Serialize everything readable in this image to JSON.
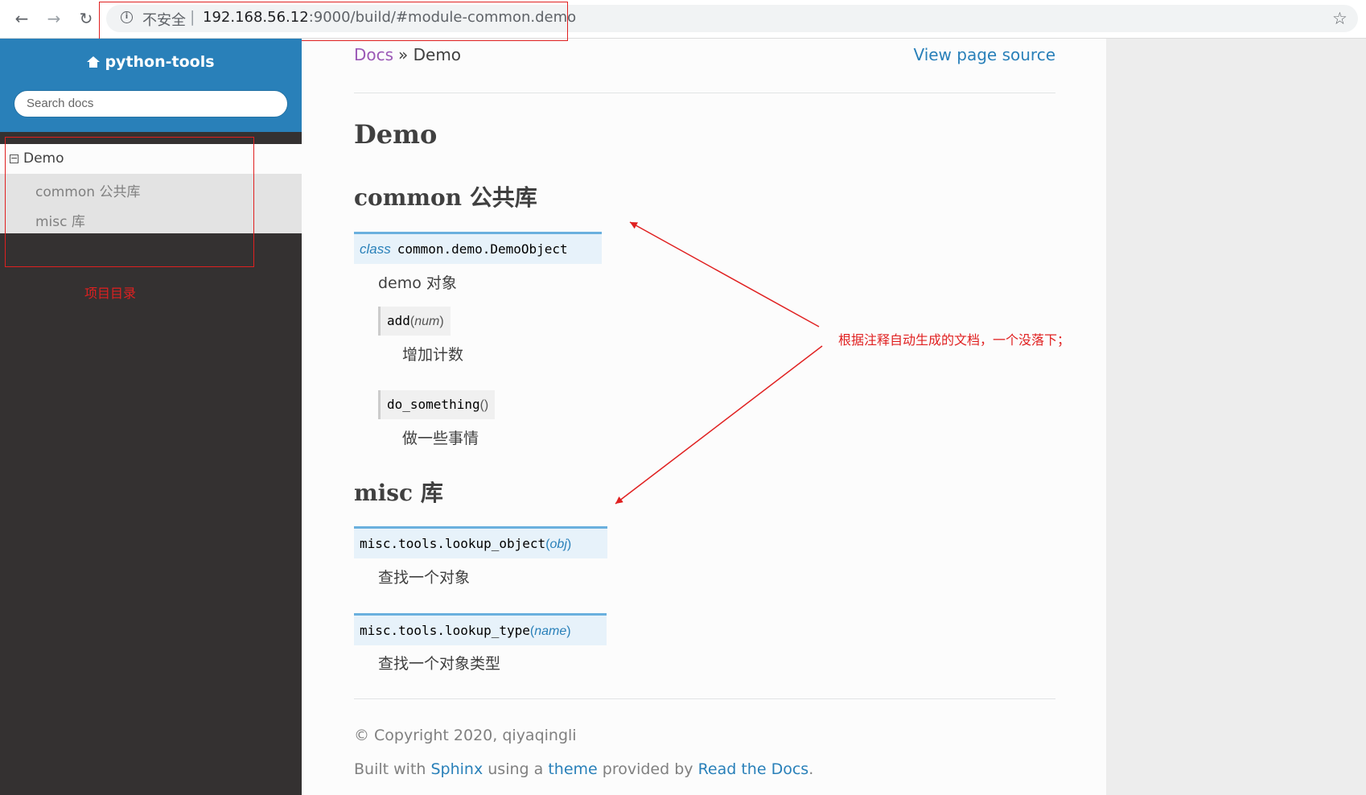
{
  "browser": {
    "insecure_label": "不安全",
    "separator": "|",
    "url_host": "192.168.56.12",
    "url_rest": ":9000/build/#module-common.demo"
  },
  "sidebar": {
    "brand": "python-tools",
    "search_placeholder": "Search docs",
    "toggle": "⊟",
    "current": "Demo",
    "items": [
      {
        "label": "common 公共库"
      },
      {
        "label": "misc 库"
      }
    ],
    "annotation": "项目目录"
  },
  "breadcrumb": {
    "docs": "Docs",
    "separator": "»",
    "current": "Demo",
    "view_source": "View page source"
  },
  "page": {
    "title": "Demo",
    "sections": [
      {
        "heading": "common 公共库",
        "class_keyword": "class",
        "class_name": "common.demo.DemoObject",
        "class_desc": "demo 对象",
        "methods": [
          {
            "name": "add",
            "param": "num",
            "desc": "增加计数"
          },
          {
            "name": "do_something",
            "param": "",
            "desc": "做一些事情"
          }
        ]
      },
      {
        "heading": "misc 库",
        "functions": [
          {
            "name": "misc.tools.lookup_object",
            "param": "obj",
            "desc": "查找一个对象"
          },
          {
            "name": "misc.tools.lookup_type",
            "param": "name",
            "desc": "查找一个对象类型"
          }
        ]
      }
    ]
  },
  "footer": {
    "copyright": "© Copyright 2020, qiyaqingli",
    "built_prefix": "Built with",
    "sphinx": "Sphinx",
    "using_a": "using a",
    "theme": "theme",
    "provided_by": "provided by",
    "rtd": "Read the Docs",
    "period": "."
  },
  "annotation_right": "根据注释自动生成的文档，一个没落下；",
  "colors": {
    "sidebar_top": "#2980b9",
    "sidebar_bg": "#343131",
    "link": "#2980b9",
    "visited": "#9b59b6",
    "annotation": "#e02020"
  }
}
